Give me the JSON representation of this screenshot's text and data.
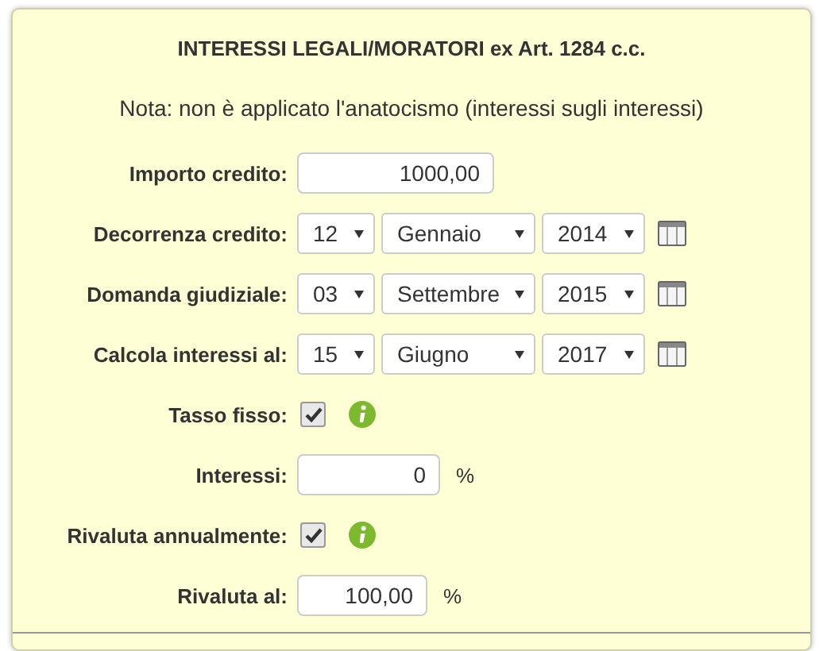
{
  "title": "INTERESSI LEGALI/MORATORI ex Art. 1284 c.c.",
  "note": "Nota: non è applicato l'anatocismo (interessi sugli interessi)",
  "fields": [
    {
      "kind": "number",
      "label": "Importo credito:",
      "value": "1000,00"
    },
    {
      "kind": "date",
      "label": "Decorrenza credito:",
      "day": "12",
      "month": "Gennaio",
      "year": "2014"
    },
    {
      "kind": "date",
      "label": "Domanda giudiziale:",
      "day": "03",
      "month": "Settembre",
      "year": "2015"
    },
    {
      "kind": "date",
      "label": "Calcola interessi al:",
      "day": "15",
      "month": "Giugno",
      "year": "2017"
    },
    {
      "kind": "checkbox",
      "label": "Tasso fisso:",
      "checked": true
    },
    {
      "kind": "number",
      "label": "Interessi:",
      "value": "0",
      "unit": "%"
    },
    {
      "kind": "checkbox",
      "label": "Rivaluta annualmente:",
      "checked": true
    },
    {
      "kind": "number",
      "label": "Rivaluta al:",
      "value": "100,00",
      "unit": "%"
    }
  ]
}
